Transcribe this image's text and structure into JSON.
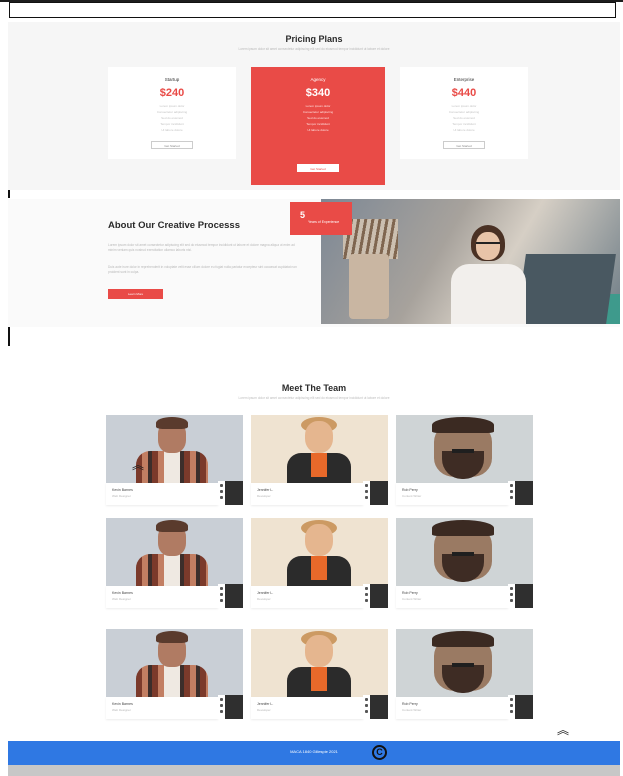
{
  "pricing": {
    "title": "Pricing Plans",
    "subtitle": "Lorem ipsum dolor sit amet consectetur adipiscing elit sed do eiusmod tempor incididunt ut labore et dolore",
    "plans": [
      {
        "name": "Startup",
        "price": "$240",
        "features": [
          "Lorem ipsum dolor",
          "Consectetur adipiscing",
          "Sed do eiusmod",
          "Tempor incididunt",
          "Ut labore dolore"
        ],
        "button": "Get Started"
      },
      {
        "name": "Agency",
        "price": "$340",
        "features": [
          "Lorem ipsum dolor",
          "Consectetur adipiscing",
          "Sed do eiusmod",
          "Tempor incididunt",
          "Ut labore dolore"
        ],
        "button": "Get Started"
      },
      {
        "name": "Enterprise",
        "price": "$440",
        "features": [
          "Lorem ipsum dolor",
          "Consectetur adipiscing",
          "Sed do eiusmod",
          "Tempor incididunt",
          "Ut labore dolore"
        ],
        "button": "Get Started"
      }
    ]
  },
  "about": {
    "title": "About Our Creative Processs",
    "para1": "Lorem ipsum dolor sit amet consectetur adipiscing elit sed do eiusmod tempor incididunt ut labore et dolore magna aliqua ut enim ad minim veniam quis nostrud exercitation ullamco laboris nisi.",
    "para2": "Duis aute irure dolor in reprehenderit in voluptate velit esse cillum dolore eu fugiat nulla pariatur excepteur sint occaecat cupidatat non proident sunt in culpa.",
    "button": "Learn More",
    "badge_number": "5",
    "badge_text": "Years of Experience"
  },
  "team": {
    "title": "Meet The Team",
    "subtitle": "Lorem ipsum dolor sit amet consectetur adipiscing elit sed do eiusmod tempor incididunt ut labore et dolore",
    "members": [
      {
        "name": "Kevin Barnes",
        "role": "Web Designer"
      },
      {
        "name": "Jennifer L.",
        "role": "Developer"
      },
      {
        "name": "Rob Perry",
        "role": "Content Writer"
      },
      {
        "name": "Kevin Barnes",
        "role": "Web Designer"
      },
      {
        "name": "Jennifer L.",
        "role": "Developer"
      },
      {
        "name": "Rob Perry",
        "role": "Content Writer"
      },
      {
        "name": "Kevin Barnes",
        "role": "Web Designer"
      },
      {
        "name": "Jennifer L.",
        "role": "Developer"
      },
      {
        "name": "Rob Perry",
        "role": "Content Writer"
      }
    ]
  },
  "footer": {
    "copyright": "MACA 1840 Gillespie 2021",
    "copyright_symbol": "C"
  },
  "icons": {
    "scroll_up": "︽",
    "accent": "#e94b47",
    "footer_color": "#2f78e3"
  }
}
